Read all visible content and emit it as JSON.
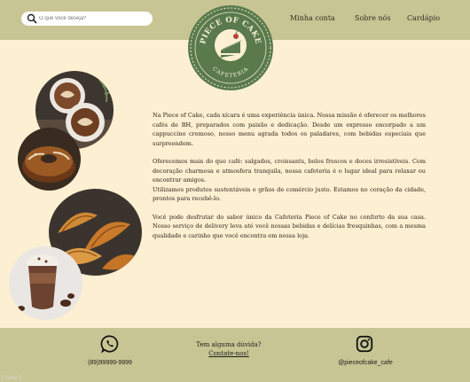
{
  "search": {
    "placeholder": "O que você deseja?"
  },
  "nav": {
    "account": "Minha conta",
    "about": "Sobre nós",
    "menu": "Cardápio"
  },
  "logo": {
    "name": "PIECE OF CAKE",
    "subtitle": "CAFETERIA"
  },
  "content": {
    "p1": "Na Piece of Cake, cada xícara é uma experiência única. Nossa missão é oferecer os melhores cafés de BH, preparados com paixão e dedicação. Desde um expresso encorpado a um cappuccino cremoso, nosso menu agrada todos os paladares, com bebidas especiais que surpreendem.",
    "p2": "Oferecemos mais do que café: salgados, croissants, bolos frescos e doces irresistíveis. Com decoração charmosa e atmosfera tranquila, nossa cafeteria é o lugar ideal para relaxar ou encontrar amigos.",
    "p3": "Utilizamos produtos sustentáveis e grãos de comércio justo. Estamos no coração da cidade, prontos para recebê-lo.",
    "p4": "Você pode desfrutar do sabor único da Cafeteria Piece of Cake no conforto da sua casa. Nosso serviço de delivery leva até você nossas bebidas e delícias fresquinhas, com a mesma qualidade e carinho que você encontra em nossa loja."
  },
  "footer": {
    "phone": "(89)99999-9999",
    "question": "Tem alguma dúvida?",
    "contact_link": "Contate-nos!",
    "instagram": "@pieceofcake_cafe"
  },
  "frame_label": "Frame 2",
  "colors": {
    "background": "#fdf0d2",
    "header": "#c7c593",
    "logo_green": "#5a7a4c"
  }
}
